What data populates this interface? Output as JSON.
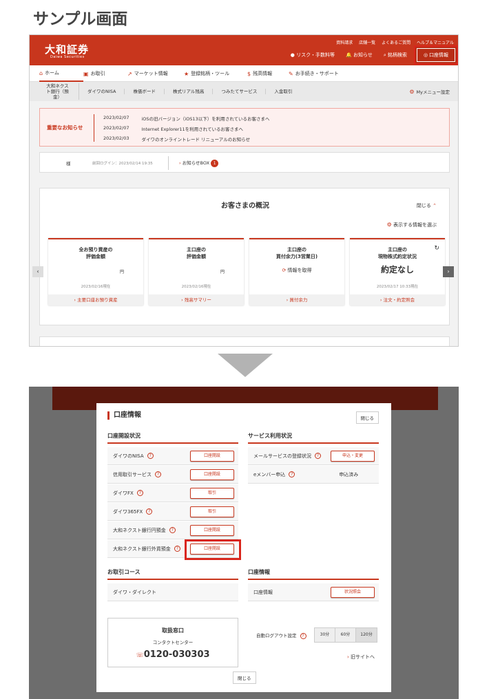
{
  "page_title": "サンプル画面",
  "top": {
    "logo": "大和証券",
    "logo_sub": "Daiwa Securities",
    "header_links": [
      "資料請求",
      "店舗一覧",
      "よくあるご質問",
      "ヘルプ＆マニュアル"
    ],
    "header_links2": [
      "リスク・手数料等",
      "お知らせ",
      "銘柄検索"
    ],
    "account_btn": "口座情報",
    "nav": [
      "ホーム",
      "お取引",
      "マーケット情報",
      "登録銘柄・ツール",
      "残高情報",
      "お手続き・サポート"
    ],
    "subnav": [
      "大和ネクスト銀行（預金）",
      "ダイワのNISA",
      "株価ボード",
      "株式リアル残高",
      "つみたてサービス",
      "入金取引"
    ],
    "mymenu": "Myメニュー設定",
    "notice_label": "重要なお知らせ",
    "notices": [
      {
        "date": "2023/02/07",
        "text": "iOSの旧バージョン（iOS13以下）を利用されているお客さまへ"
      },
      {
        "date": "2023/02/07",
        "text": "Internet Explorer11を利用されているお客さまへ"
      },
      {
        "date": "2023/02/03",
        "text": "ダイワのオンライントレード リニューアルのお知らせ"
      }
    ],
    "user_suffix": "様",
    "last_login": "前回ログイン：2023/02/14 19:35",
    "notice_box": "お知らせBOX",
    "notice_count": "1",
    "overview_title": "お客さまの概況",
    "close": "閉じる",
    "display_setting": "表示する情報を選ぶ",
    "cards": [
      {
        "t1": "全お預り資産の",
        "t2": "評価金額",
        "val": "円",
        "date": "2023/02/16現在",
        "link": "主要口座お預り資産"
      },
      {
        "t1": "主口座の",
        "t2": "評価金額",
        "val": "円",
        "date": "2023/02/16現在",
        "link": "残高サマリー"
      },
      {
        "t1": "主口座の",
        "t2": "買付余力(3営業日)",
        "val": "情報を取得",
        "date": "",
        "link": "買付余力"
      },
      {
        "t1": "主口座の",
        "t2": "現物株式約定状況",
        "val": "約定なし",
        "date": "2023/02/17 10:33現在",
        "link": "注文・約定照会"
      }
    ]
  },
  "modal": {
    "title": "口座情報",
    "close": "閉じる",
    "sec_open": "口座開設状況",
    "open_rows": [
      {
        "label": "ダイワのNISA",
        "btn": "口座開設"
      },
      {
        "label": "信用取引サービス",
        "btn": "口座開設"
      },
      {
        "label": "ダイワFX",
        "btn": "取引"
      },
      {
        "label": "ダイワ365FX",
        "btn": "取引"
      },
      {
        "label": "大和ネクスト銀行円預金",
        "btn": "口座開設"
      },
      {
        "label": "大和ネクスト銀行外貨預金",
        "btn": "口座開設"
      }
    ],
    "sec_service": "サービス利用状況",
    "service_rows": [
      {
        "label": "メールサービスの登録状況",
        "btn": "申込・変更"
      },
      {
        "label": "eメンバー申込",
        "value": "申込済み"
      }
    ],
    "sec_course": "お取引コース",
    "course": "ダイワ・ダイレクト",
    "sec_account": "口座情報",
    "account_row": "口座情報",
    "account_btn": "状況照会",
    "contact_title": "取扱窓口",
    "contact_sub": "コンタクトセンター",
    "contact_tel": "0120-030303",
    "logout_label": "自動ログアウト設定",
    "logout_opts": [
      "30分",
      "60分",
      "120分"
    ],
    "old_site": "旧サイトへ",
    "bottom_close": "閉じる"
  }
}
